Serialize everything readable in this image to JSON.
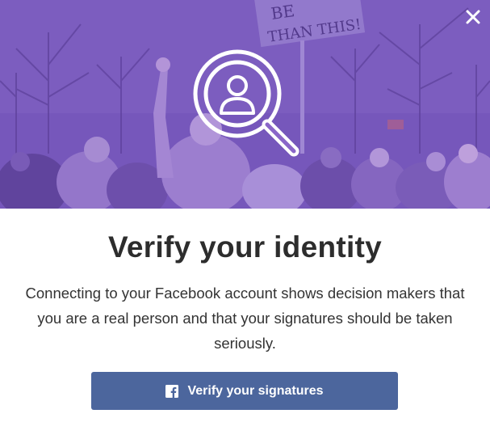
{
  "dialog": {
    "hero_sign_text_line1": "BE",
    "hero_sign_text_line2": "THAN THIS!",
    "title": "Verify your identity",
    "description": "Connecting to your Facebook account shows decision makers that you are a real person and that your signatures should be taken seriously.",
    "button_label": "Verify your signatures",
    "close_icon": "close-icon",
    "hero_icon": "user-search-icon",
    "button_icon": "facebook-icon"
  },
  "colors": {
    "hero_tint": "#7a58bf",
    "button_bg": "#4c669d",
    "title_text": "#2d2d2d",
    "body_text": "#333333"
  }
}
